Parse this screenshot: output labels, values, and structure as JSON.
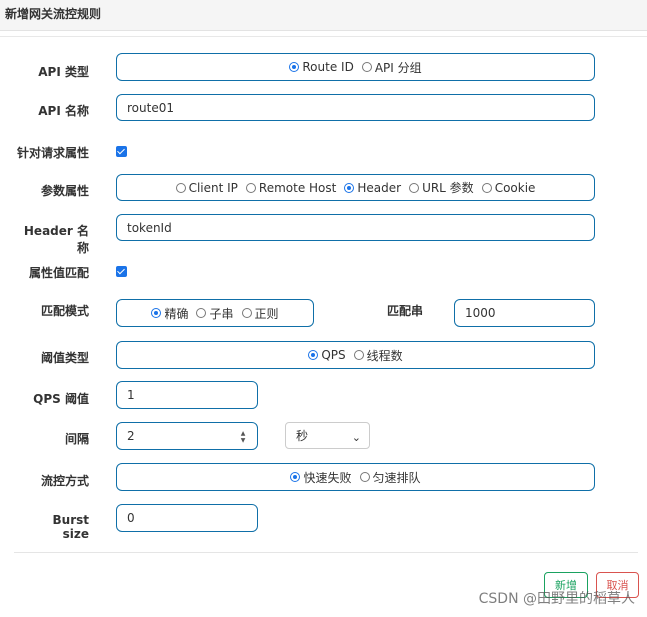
{
  "dialog": {
    "title": "新增网关流控规则"
  },
  "form": {
    "api_type": {
      "label": "API 类型",
      "options": [
        "Route ID",
        "API 分组"
      ],
      "selected": "Route ID"
    },
    "api_name": {
      "label": "API 名称",
      "value": "route01"
    },
    "match_request_attr": {
      "label": "针对请求属性",
      "checked": true
    },
    "param_attr": {
      "label": "参数属性",
      "options": [
        "Client IP",
        "Remote Host",
        "Header",
        "URL 参数",
        "Cookie"
      ],
      "selected": "Header"
    },
    "header_name": {
      "label": "Header 名称",
      "value": "tokenId"
    },
    "attr_value_match": {
      "label": "属性值匹配",
      "checked": true
    },
    "match_mode": {
      "label": "匹配模式",
      "options": [
        "精确",
        "子串",
        "正则"
      ],
      "selected": "精确"
    },
    "match_string": {
      "label": "匹配串",
      "value": "1000"
    },
    "threshold_type": {
      "label": "阈值类型",
      "options": [
        "QPS",
        "线程数"
      ],
      "selected": "QPS"
    },
    "qps_threshold": {
      "label": "QPS 阈值",
      "value": "1"
    },
    "interval": {
      "label": "间隔",
      "value": "2",
      "unit": "秒"
    },
    "control_behavior": {
      "label": "流控方式",
      "options": [
        "快速失败",
        "匀速排队"
      ],
      "selected": "快速失败"
    },
    "burst_size": {
      "label": "Burst size",
      "value": "0"
    }
  },
  "footer": {
    "add_label": "新增",
    "cancel_label": "取消"
  },
  "watermark": "CSDN @田野里的稻草人",
  "colors": {
    "border": "#0f6fa8",
    "primary": "#1a73e8",
    "success": "#1aa260",
    "danger": "#d9534f"
  }
}
